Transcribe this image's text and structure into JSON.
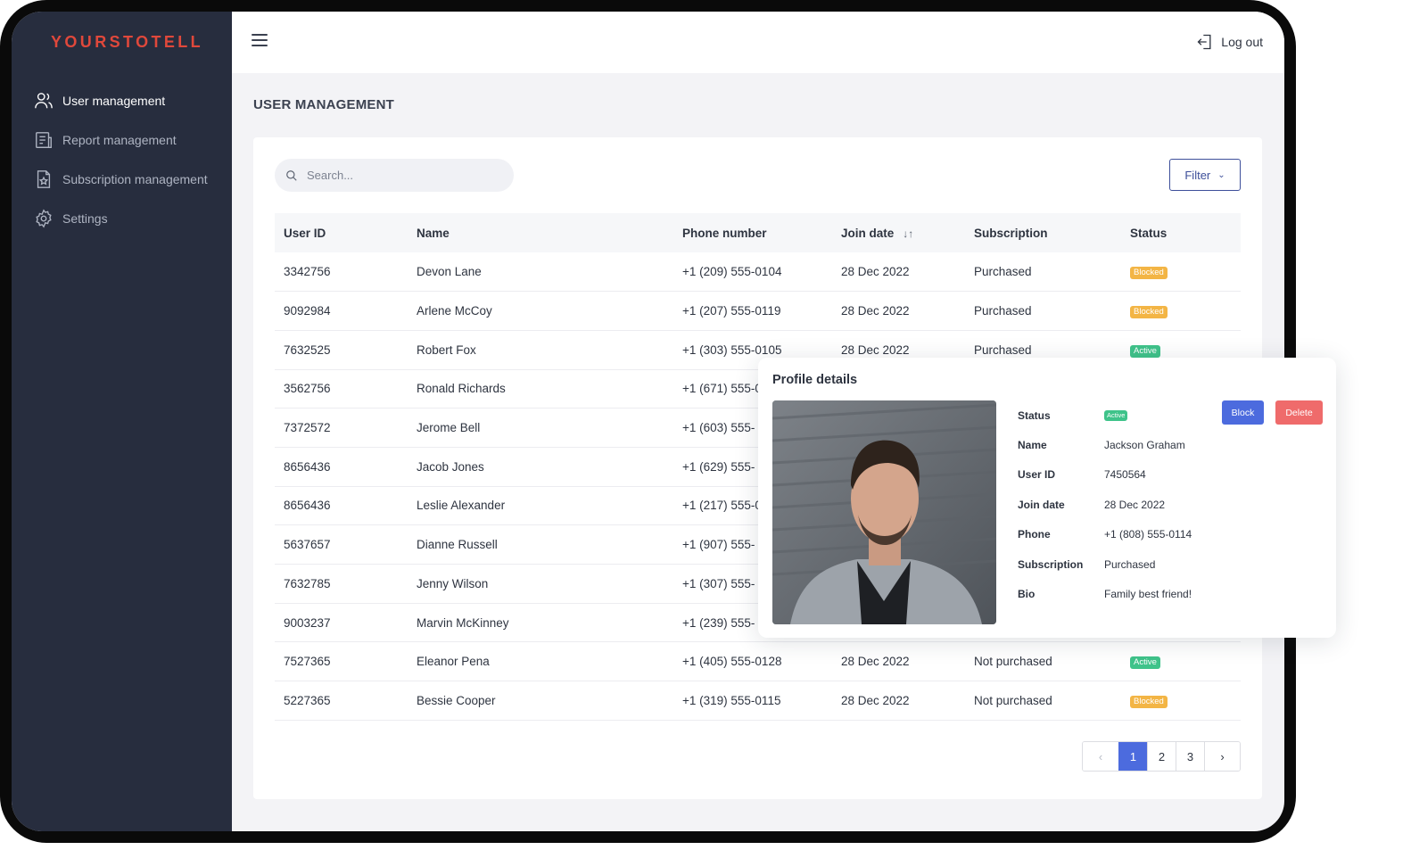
{
  "app": {
    "logo": "YOURSTOTELL"
  },
  "sidebar": {
    "items": [
      {
        "label": "User management",
        "icon": "users-icon",
        "active": true
      },
      {
        "label": "Report management",
        "icon": "report-icon",
        "active": false
      },
      {
        "label": "Subscription management",
        "icon": "subscription-icon",
        "active": false
      },
      {
        "label": "Settings",
        "icon": "gear-icon",
        "active": false
      }
    ]
  },
  "topbar": {
    "menu_icon": "hamburger-icon",
    "logout_label": "Log out",
    "logout_icon": "logout-icon"
  },
  "page": {
    "title": "USER MANAGEMENT"
  },
  "toolbar": {
    "search_placeholder": "Search...",
    "filter_label": "Filter"
  },
  "table": {
    "columns": [
      "User ID",
      "Name",
      "Phone number",
      "Join date",
      "Subscription",
      "Status"
    ],
    "rows": [
      {
        "id": "3342756",
        "name": "Devon Lane",
        "phone": "+1 (209) 555-0104",
        "join": "28 Dec 2022",
        "subscription": "Purchased",
        "status": "Blocked"
      },
      {
        "id": "9092984",
        "name": "Arlene McCoy",
        "phone": "+1 (207) 555-0119",
        "join": "28 Dec 2022",
        "subscription": "Purchased",
        "status": "Blocked"
      },
      {
        "id": "7632525",
        "name": "Robert Fox",
        "phone": "+1 (303) 555-0105",
        "join": "28 Dec 2022",
        "subscription": "Purchased",
        "status": "Active"
      },
      {
        "id": "3562756",
        "name": "Ronald Richards",
        "phone": "+1 (671) 555-0",
        "join": "",
        "subscription": "",
        "status": ""
      },
      {
        "id": "7372572",
        "name": "Jerome Bell",
        "phone": "+1 (603) 555-",
        "join": "",
        "subscription": "",
        "status": ""
      },
      {
        "id": "8656436",
        "name": "Jacob Jones",
        "phone": "+1 (629) 555-",
        "join": "",
        "subscription": "",
        "status": ""
      },
      {
        "id": "8656436",
        "name": "Leslie Alexander",
        "phone": "+1 (217) 555-0",
        "join": "",
        "subscription": "",
        "status": ""
      },
      {
        "id": "5637657",
        "name": "Dianne Russell",
        "phone": "+1 (907) 555-",
        "join": "",
        "subscription": "",
        "status": ""
      },
      {
        "id": "7632785",
        "name": "Jenny Wilson",
        "phone": "+1 (307) 555-",
        "join": "",
        "subscription": "",
        "status": ""
      },
      {
        "id": "9003237",
        "name": "Marvin McKinney",
        "phone": "+1 (239) 555-",
        "join": "",
        "subscription": "",
        "status": ""
      },
      {
        "id": "7527365",
        "name": "Eleanor Pena",
        "phone": "+1 (405) 555-0128",
        "join": "28 Dec 2022",
        "subscription": "Not purchased",
        "status": "Active"
      },
      {
        "id": "5227365",
        "name": "Bessie Cooper",
        "phone": "+1 (319) 555-0115",
        "join": "28 Dec 2022",
        "subscription": "Not purchased",
        "status": "Blocked"
      }
    ]
  },
  "pagination": {
    "prev": "‹",
    "pages": [
      "1",
      "2",
      "3"
    ],
    "current": "1",
    "next": "›"
  },
  "profile": {
    "title": "Profile details",
    "fields": [
      {
        "label": "Status",
        "value": "Active",
        "badge": true
      },
      {
        "label": "Name",
        "value": "Jackson Graham"
      },
      {
        "label": "User ID",
        "value": "7450564"
      },
      {
        "label": "Join date",
        "value": "28 Dec 2022"
      },
      {
        "label": "Phone",
        "value": "+1 (808) 555-0114"
      },
      {
        "label": "Subscription",
        "value": "Purchased"
      },
      {
        "label": "Bio",
        "value": "Family best friend!"
      }
    ],
    "block_label": "Block",
    "delete_label": "Delete"
  },
  "colors": {
    "accent": "#4c6bde",
    "danger": "#ef6b6b",
    "blocked": "#f3b545",
    "active": "#3fc38a",
    "sidebar": "#272d3e",
    "logo": "#e0483b"
  }
}
